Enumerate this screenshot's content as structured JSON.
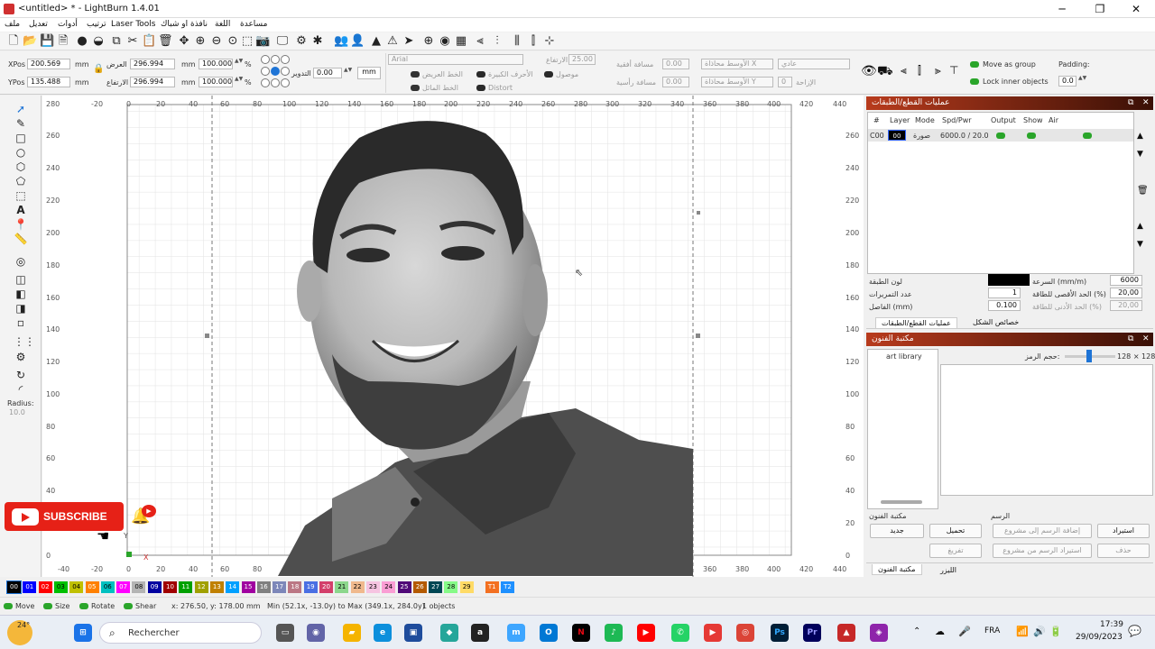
{
  "window": {
    "title": "<untitled> * - LightBurn 1.4.01"
  },
  "menu": [
    "ملف",
    "تعديل",
    "أدوات",
    "ترتيب",
    "Laser Tools",
    "نافذة او شباك",
    "اللغة",
    "مساعدة"
  ],
  "toolbar2": {
    "xpos_label": "XPos",
    "xpos": "200.569",
    "ypos_label": "YPos",
    "ypos": "135.488",
    "unit": "mm",
    "width_label": "العرض",
    "width": "296.994",
    "height_label": "الارتفاع",
    "height": "296.994",
    "scale_w": "100.000",
    "scale_h": "100.000",
    "percent": "%",
    "rotate_label": "التدوير",
    "rotate": "0.00",
    "rotate_unit": "mm",
    "font": "Arial",
    "font_height_label": "الارتفاع",
    "font_height": "25.00",
    "hspace_label": "مسافة أفقية",
    "hspace": "0.00",
    "vspace_label": "مسافة رأسية",
    "vspace": "0.00",
    "bold": "الخط العريض",
    "italic": "الخط المائل",
    "caps": "الأحرف الكبيرة",
    "welded": "موصول",
    "distort": "Distort",
    "align_x": "الأوسط محاذاة X",
    "align_y": "الأوسط محاذاة Y",
    "normal": "عادي",
    "offset_label": "الإزاحة",
    "offset": "0",
    "move_group": "Move as group",
    "lock_inner": "Lock inner objects",
    "padding_label": "Padding:",
    "padding": "0.0"
  },
  "left_tools": {
    "radius_label": "Radius:",
    "radius": "10.0"
  },
  "ruler": {
    "top": [
      "-20",
      "0",
      "20",
      "40",
      "60",
      "80",
      "100",
      "120",
      "140",
      "160",
      "180",
      "200",
      "220",
      "240",
      "260",
      "280",
      "300",
      "320",
      "340",
      "360",
      "380",
      "400",
      "420"
    ],
    "bottom": [
      "-40",
      "-20",
      "0",
      "20",
      "40",
      "60",
      "80",
      "360",
      "380",
      "400",
      "420",
      "440"
    ],
    "left": [
      "260",
      "240",
      "220",
      "200",
      "180",
      "160",
      "140",
      "120",
      "100",
      "80",
      "60",
      "40",
      "20",
      "0"
    ],
    "corner_tl": "280",
    "corner_tr": "440",
    "corner_tr2": "440",
    "axis_y": "Y",
    "axis_x": "X"
  },
  "cuts": {
    "header": "عمليات القطع/الطبقات",
    "columns": [
      "#",
      "Layer",
      "Mode",
      "Spd/Pwr",
      "Output",
      "Show",
      "Air"
    ],
    "row": {
      "num": "C00",
      "layer": "00",
      "mode": "صورة",
      "spdpwr": "6000.0 / 20.0"
    },
    "layer_color": "لون الطبقة",
    "speed_label": "السرعة (mm/m)",
    "speed": "6000",
    "passes_label": "عدد التمريرات",
    "passes": "1",
    "maxpow_label": "الحد الأقصى للطاقة (%)",
    "maxpow": "20,00",
    "interval_label": "الفاصل (mm)",
    "interval": "0.100",
    "minpow_label": "الحد الأدنى للطاقة (%)",
    "minpow": "20,00",
    "tab1": "عمليات القطع/الطبقات",
    "tab2": "خصائص الشكل"
  },
  "art": {
    "header": "مكتبة الفنون",
    "lib_item": "art library",
    "size_label": "حجم الرمز:",
    "size": "128 × 128",
    "section_lib": "مكتبة الفنون",
    "section_draw": "الرسم",
    "new": "جديد",
    "load": "تحميل",
    "unload": "تفريغ",
    "import": "استيراد",
    "add_to_project": "إضافة الرسم إلى مشروع",
    "import_from_project": "استيراد الرسم من مشروع",
    "delete": "حذف",
    "tab1": "مكتبة الفنون",
    "tab2": "الليزر"
  },
  "palette": [
    {
      "l": "00",
      "c": "#000000"
    },
    {
      "l": "01",
      "c": "#0000ff"
    },
    {
      "l": "02",
      "c": "#ff0000"
    },
    {
      "l": "03",
      "c": "#00c000"
    },
    {
      "l": "04",
      "c": "#c0c000"
    },
    {
      "l": "05",
      "c": "#ff8000"
    },
    {
      "l": "06",
      "c": "#00c0c0"
    },
    {
      "l": "07",
      "c": "#ff00ff"
    },
    {
      "l": "08",
      "c": "#b4b4b4"
    },
    {
      "l": "09",
      "c": "#0000a0"
    },
    {
      "l": "10",
      "c": "#a00000"
    },
    {
      "l": "11",
      "c": "#00a000"
    },
    {
      "l": "12",
      "c": "#a0a000"
    },
    {
      "l": "13",
      "c": "#c08000"
    },
    {
      "l": "14",
      "c": "#00a0ff"
    },
    {
      "l": "15",
      "c": "#a000a0"
    },
    {
      "l": "16",
      "c": "#808080"
    },
    {
      "l": "17",
      "c": "#7d87b9"
    },
    {
      "l": "18",
      "c": "#bb7784"
    },
    {
      "l": "19",
      "c": "#4a6fe3"
    },
    {
      "l": "20",
      "c": "#d33f6a"
    },
    {
      "l": "21",
      "c": "#8cd78c"
    },
    {
      "l": "22",
      "c": "#f0b98d"
    },
    {
      "l": "23",
      "c": "#f6c4e1"
    },
    {
      "l": "24",
      "c": "#fa9ed4"
    },
    {
      "l": "25",
      "c": "#500a78"
    },
    {
      "l": "26",
      "c": "#b45a00"
    },
    {
      "l": "27",
      "c": "#004754"
    },
    {
      "l": "28",
      "c": "#86fa88"
    },
    {
      "l": "29",
      "c": "#ffdb66"
    },
    {
      "l": "T1",
      "c": "#f37021"
    },
    {
      "l": "T2",
      "c": "#1e90ff"
    }
  ],
  "status": {
    "move": "Move",
    "size": "Size",
    "rotate": "Rotate",
    "shear": "Shear",
    "coords": "x: 276.50, y: 178.00 mm",
    "minmax": "Min (52.1x, -13.0y) to Max (349.1x, 284.0y)",
    "objects": "1 objects"
  },
  "taskbar": {
    "temp": "24°",
    "search": "Rechercher",
    "lang": "FRA",
    "time": "17:39",
    "date": "29/09/2023"
  },
  "overlay": {
    "subscribe": "SUBSCRIBE"
  }
}
